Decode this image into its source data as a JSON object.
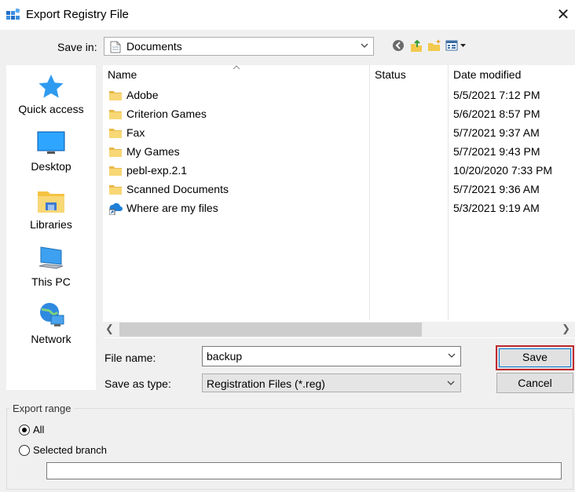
{
  "window": {
    "title": "Export Registry File",
    "close_glyph": "✕"
  },
  "save_in": {
    "label": "Save in:",
    "value": "Documents"
  },
  "places": [
    {
      "label": "Quick access",
      "icon": "star-icon"
    },
    {
      "label": "Desktop",
      "icon": "desktop-icon"
    },
    {
      "label": "Libraries",
      "icon": "libraries-icon"
    },
    {
      "label": "This PC",
      "icon": "computer-icon"
    },
    {
      "label": "Network",
      "icon": "network-icon"
    }
  ],
  "file_list": {
    "columns": {
      "name": "Name",
      "status": "Status",
      "date": "Date modified"
    },
    "rows": [
      {
        "name": "Adobe",
        "date": "5/5/2021 7:12 PM",
        "icon": "folder-icon"
      },
      {
        "name": "Criterion Games",
        "date": "5/6/2021 8:57 PM",
        "icon": "folder-icon"
      },
      {
        "name": "Fax",
        "date": "5/7/2021 9:37 AM",
        "icon": "folder-icon"
      },
      {
        "name": "My Games",
        "date": "5/7/2021 9:43 PM",
        "icon": "folder-icon"
      },
      {
        "name": "pebl-exp.2.1",
        "date": "10/20/2020 7:33 PM",
        "icon": "folder-icon"
      },
      {
        "name": "Scanned Documents",
        "date": "5/7/2021 9:36 AM",
        "icon": "folder-icon"
      },
      {
        "name": "Where are my files",
        "date": "5/3/2021 9:19 AM",
        "icon": "cloud-shortcut-icon"
      }
    ]
  },
  "file_name": {
    "label": "File name:",
    "value": "backup"
  },
  "save_as_type": {
    "label": "Save as type:",
    "value": "Registration Files (*.reg)"
  },
  "buttons": {
    "save": "Save",
    "cancel": "Cancel"
  },
  "export_range": {
    "label": "Export range",
    "options": [
      {
        "label": "All",
        "selected": true
      },
      {
        "label": "Selected branch",
        "selected": false
      }
    ],
    "branch_value": ""
  },
  "colors": {
    "accent": "#0078d7",
    "focus_highlight": "#c0282f",
    "folder": "#f8d775"
  }
}
